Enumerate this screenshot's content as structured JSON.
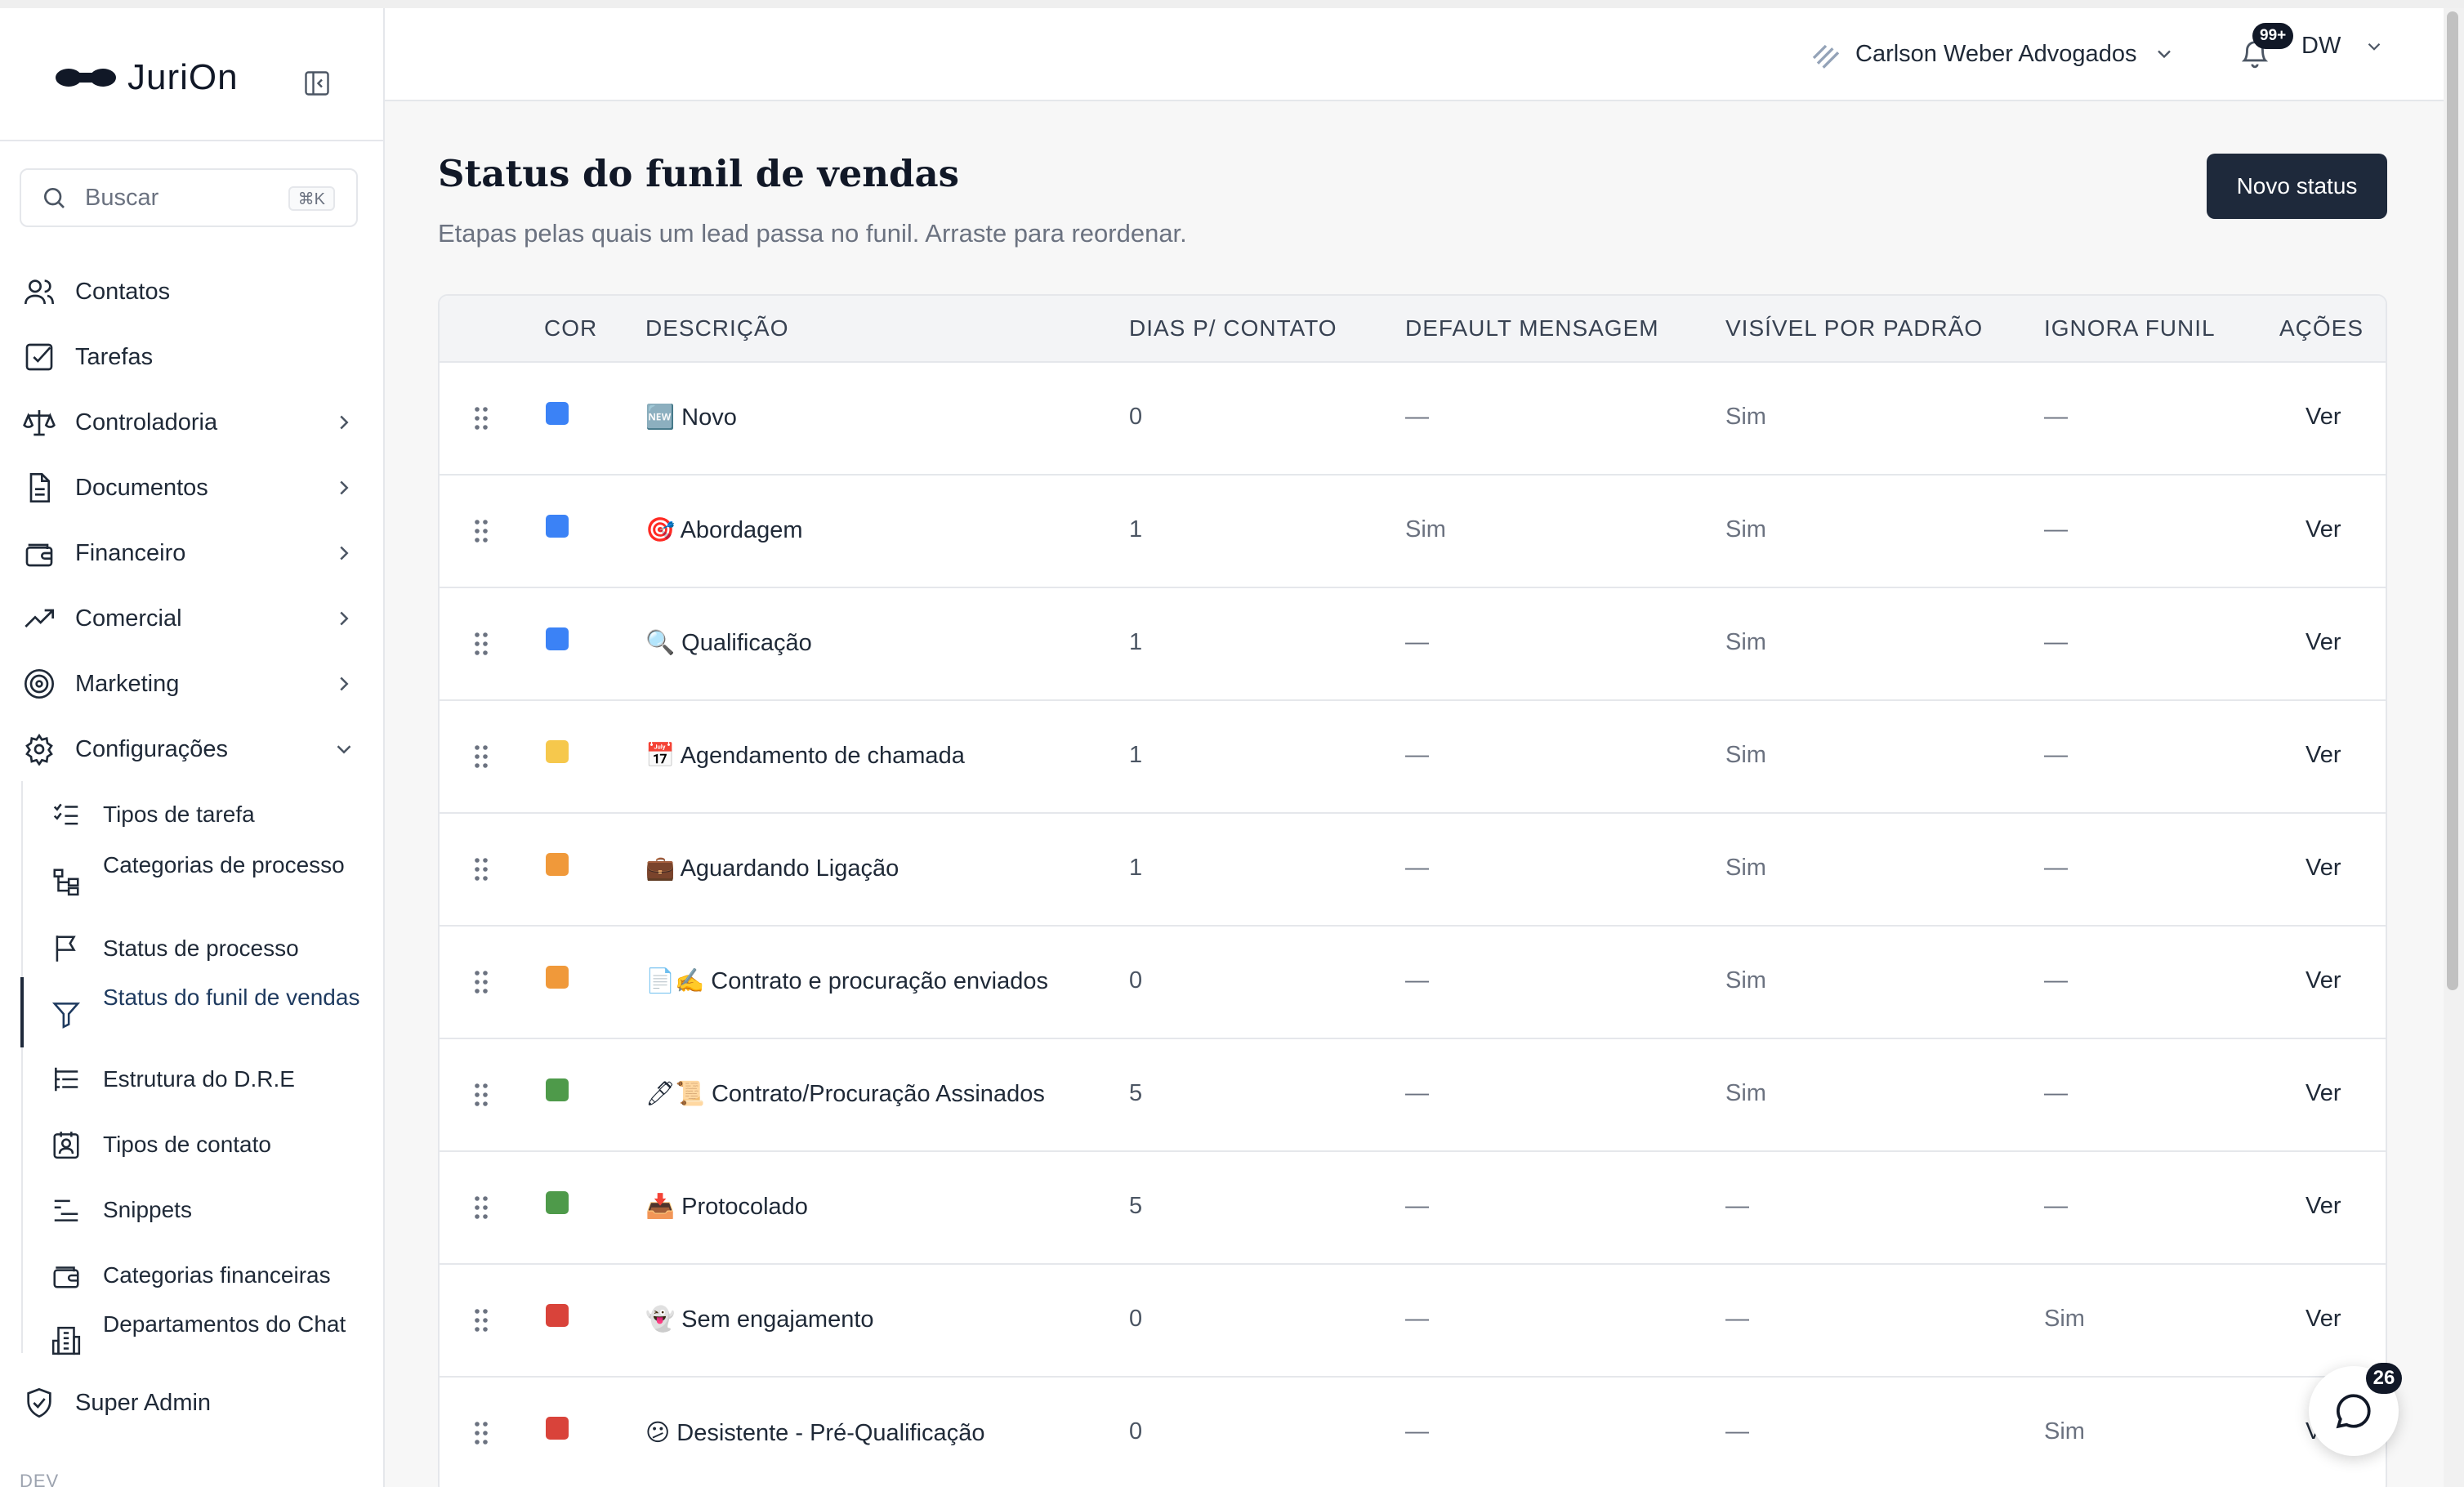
{
  "app": {
    "name": "JuriOn"
  },
  "search": {
    "placeholder": "Buscar",
    "shortcut": "⌘K"
  },
  "sidebar": {
    "items": [
      {
        "label": "Contatos",
        "icon": "users-icon"
      },
      {
        "label": "Tarefas",
        "icon": "check-square-icon"
      },
      {
        "label": "Controladoria",
        "icon": "scale-icon",
        "has_children": true
      },
      {
        "label": "Documentos",
        "icon": "document-icon",
        "has_children": true
      },
      {
        "label": "Financeiro",
        "icon": "wallet-icon",
        "has_children": true
      },
      {
        "label": "Comercial",
        "icon": "trending-up-icon",
        "has_children": true
      },
      {
        "label": "Marketing",
        "icon": "target-icon",
        "has_children": true
      },
      {
        "label": "Configurações",
        "icon": "gear-icon",
        "expanded": true
      }
    ],
    "sub_items": [
      {
        "label": "Tipos de tarefa",
        "icon": "list-checks-icon"
      },
      {
        "label": "Categorias de processo",
        "icon": "hierarchy-icon"
      },
      {
        "label": "Status de processo",
        "icon": "flag-icon"
      },
      {
        "label": "Status do funil de vendas",
        "icon": "filter-icon",
        "active": true
      },
      {
        "label": "Estrutura do D.R.E",
        "icon": "tree-list-icon"
      },
      {
        "label": "Tipos de contato",
        "icon": "contact-card-icon"
      },
      {
        "label": "Snippets",
        "icon": "text-lines-icon"
      },
      {
        "label": "Categorias financeiras",
        "icon": "wallet-icon"
      },
      {
        "label": "Departamentos do Chat",
        "icon": "building-icon"
      }
    ],
    "super_admin": "Super Admin",
    "env_label": "DEV"
  },
  "header": {
    "org_name": "Carlson Weber Advogados",
    "notifications_badge": "99+",
    "user_initials": "DW"
  },
  "page": {
    "title": "Status do funil de vendas",
    "subtitle": "Etapas pelas quais um lead passa no funil. Arraste para reordenar.",
    "new_button": "Novo status"
  },
  "table": {
    "headers": {
      "cor": "COR",
      "descricao": "DESCRIÇÃO",
      "dias": "DIAS P/ CONTATO",
      "default_msg": "DEFAULT MENSAGEM",
      "visivel": "VISÍVEL POR PADRÃO",
      "ignora": "IGNORA FUNIL",
      "acoes": "AÇÕES"
    },
    "rows": [
      {
        "color": "#3b82f6",
        "descricao": "🆕 Novo",
        "dias": "0",
        "default_msg": "—",
        "visivel": "Sim",
        "ignora": "—",
        "acao": "Ver"
      },
      {
        "color": "#3b82f6",
        "descricao": "🎯 Abordagem",
        "dias": "1",
        "default_msg": "Sim",
        "visivel": "Sim",
        "ignora": "—",
        "acao": "Ver"
      },
      {
        "color": "#3b82f6",
        "descricao": "🔍 Qualificação",
        "dias": "1",
        "default_msg": "—",
        "visivel": "Sim",
        "ignora": "—",
        "acao": "Ver"
      },
      {
        "color": "#f6c84c",
        "descricao": "📅 Agendamento de chamada",
        "dias": "1",
        "default_msg": "—",
        "visivel": "Sim",
        "ignora": "—",
        "acao": "Ver"
      },
      {
        "color": "#f0993a",
        "descricao": "💼 Aguardando Ligação",
        "dias": "1",
        "default_msg": "—",
        "visivel": "Sim",
        "ignora": "—",
        "acao": "Ver"
      },
      {
        "color": "#f0993a",
        "descricao": "📄✍️ Contrato e procuração enviados",
        "dias": "0",
        "default_msg": "—",
        "visivel": "Sim",
        "ignora": "—",
        "acao": "Ver"
      },
      {
        "color": "#4e9a4a",
        "descricao": "🖊📜 Contrato/Procuração Assinados",
        "dias": "5",
        "default_msg": "—",
        "visivel": "Sim",
        "ignora": "—",
        "acao": "Ver"
      },
      {
        "color": "#4e9a4a",
        "descricao": "📥 Protocolado",
        "dias": "5",
        "default_msg": "—",
        "visivel": "—",
        "ignora": "—",
        "acao": "Ver"
      },
      {
        "color": "#d9433a",
        "descricao": "👻 Sem engajamento",
        "dias": "0",
        "default_msg": "—",
        "visivel": "—",
        "ignora": "Sim",
        "acao": "Ver"
      },
      {
        "color": "#d9433a",
        "descricao": "😕 Desistente - Pré-Qualificação",
        "dias": "0",
        "default_msg": "—",
        "visivel": "—",
        "ignora": "Sim",
        "acao": "Ver"
      }
    ]
  },
  "chat": {
    "badge": "26"
  }
}
